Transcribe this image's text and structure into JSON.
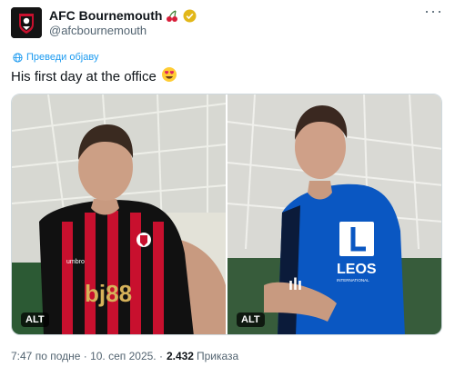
{
  "account": {
    "name": "AFC Bournemouth",
    "handle": "@afcbournemouth",
    "emoji_icon": "cherries-icon",
    "verified_icon": "verified-gold-icon"
  },
  "translate_label": "Преведи објаву",
  "tweet_text": "His first day at the office",
  "tweet_emoji_icon": "heart-eyes-icon",
  "media": [
    {
      "alt_label": "ALT",
      "jersey_colors": [
        "#c8102e",
        "#111111"
      ],
      "sponsor": "bj88"
    },
    {
      "alt_label": "ALT",
      "jersey_colors": [
        "#0a57c2",
        "#0b1b3a"
      ],
      "sponsor": "LEOS",
      "sponsor_sub": "INTERNATIONAL"
    }
  ],
  "meta": {
    "time_date": "7:47 по подне · 10. сеп 2025. ·",
    "views_count": "2.432",
    "views_label": "Приказа"
  }
}
